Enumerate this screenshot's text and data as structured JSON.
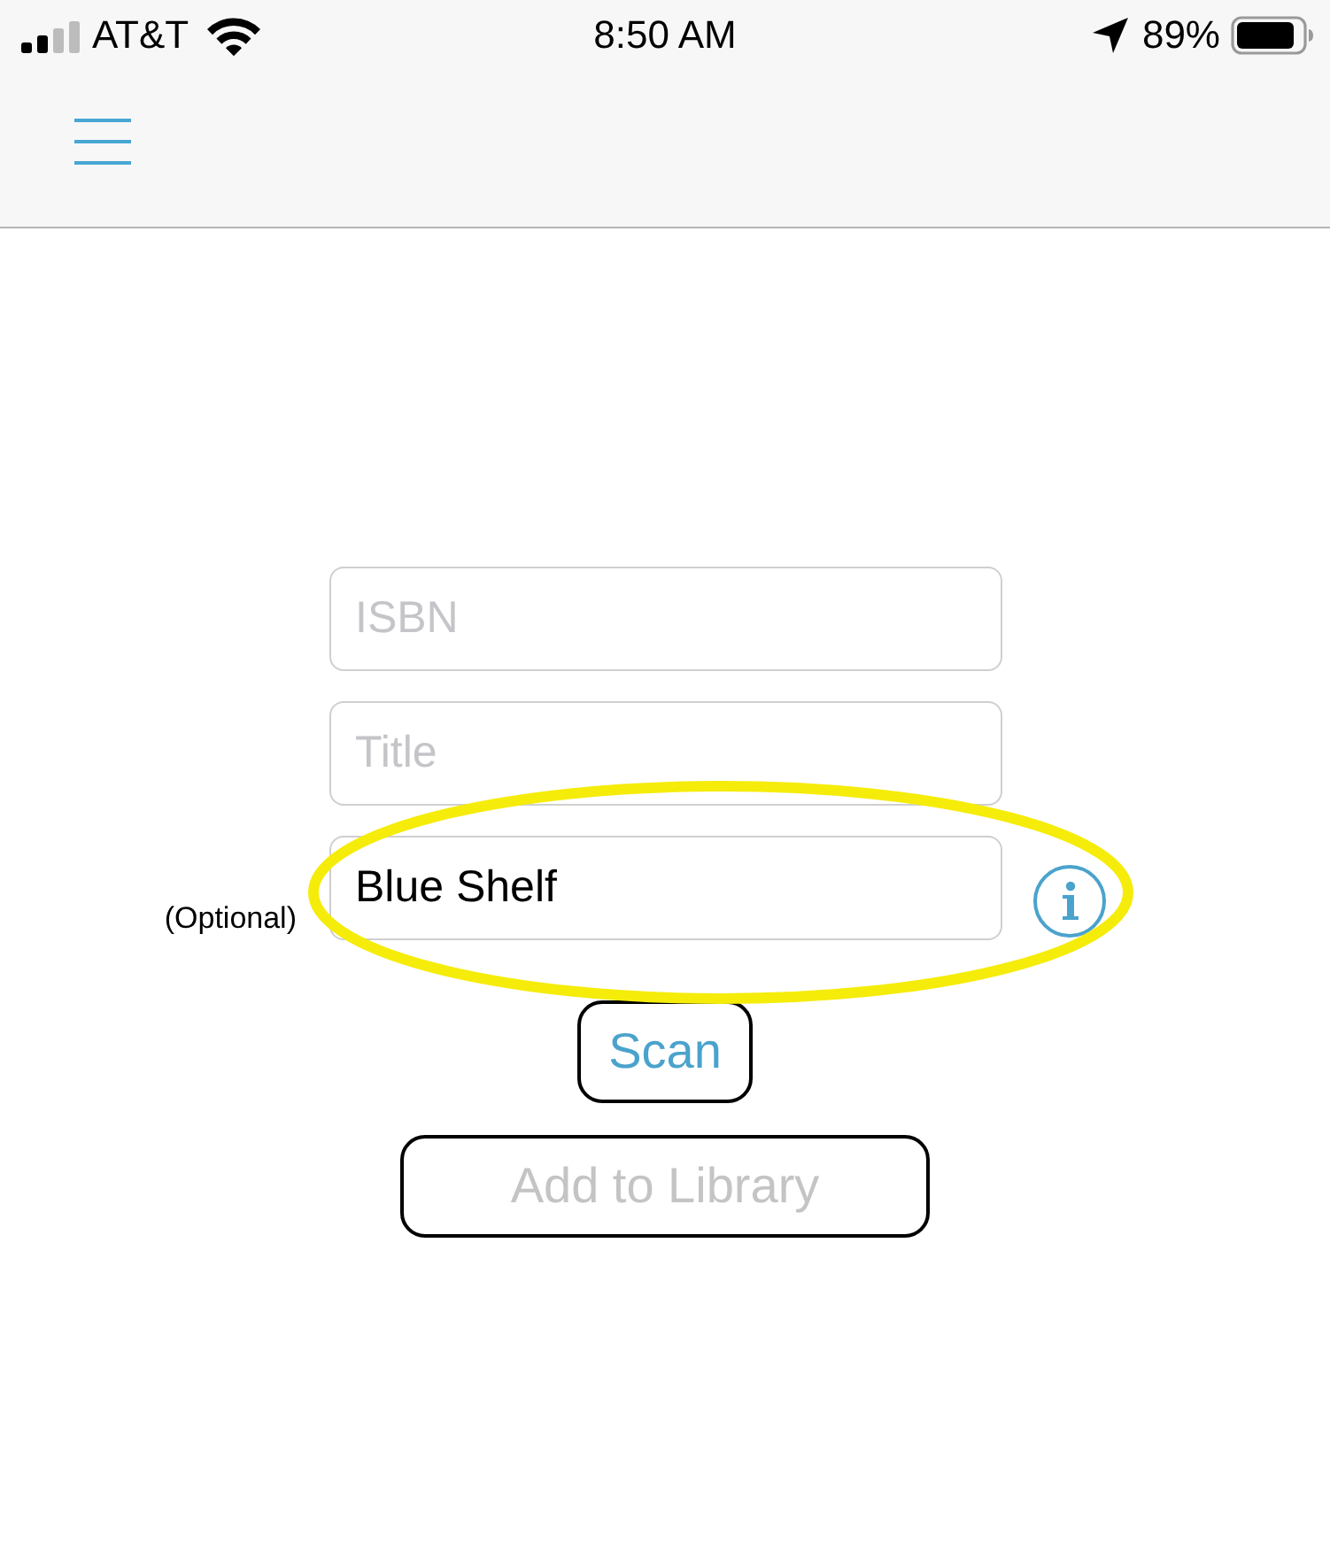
{
  "status_bar": {
    "carrier": "AT&T",
    "time": "8:50 AM",
    "battery": "89%"
  },
  "form": {
    "fields": [
      {
        "placeholder": "ISBN",
        "highlighted": false
      },
      {
        "placeholder": "Title",
        "highlighted": false
      },
      {
        "value": "Blue Shelf",
        "label": "(Optional)",
        "info": true,
        "highlighted": true
      }
    ],
    "buttons": [
      {
        "label": "Scan",
        "disabled": false
      },
      {
        "label": "Add to Library",
        "disabled": true
      }
    ]
  }
}
